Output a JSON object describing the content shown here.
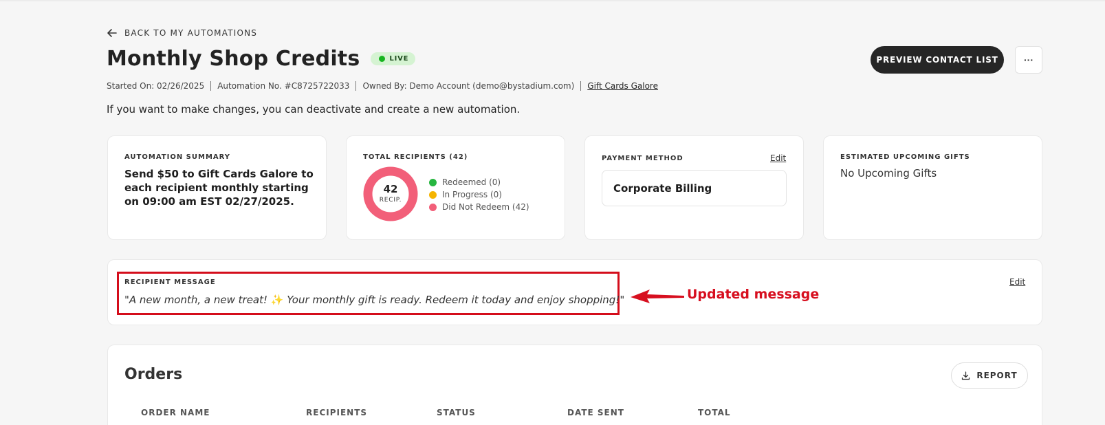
{
  "header": {
    "back_label": "BACK TO MY AUTOMATIONS",
    "title": "Monthly Shop Credits",
    "status_badge": "LIVE",
    "meta": {
      "started": "Started On: 02/26/2025",
      "automation_no": "Automation No. #C8725722033",
      "owner": "Owned By: Demo Account (demo@bystadium.com)",
      "merchant": "Gift Cards Galore"
    },
    "info": "If you want to make changes, you can deactivate and create a new automation.",
    "preview_button": "PREVIEW CONTACT LIST",
    "more_button": "···"
  },
  "cards": {
    "summary": {
      "label": "AUTOMATION SUMMARY",
      "text": "Send $50 to Gift Cards Galore to each recipient monthly starting on 09:00 am EST 02/27/2025."
    },
    "recipients": {
      "label": "TOTAL RECIPIENTS (42)",
      "count": "42",
      "unit": "RECIP.",
      "legend": [
        {
          "label": "Redeemed (0)",
          "value": 0,
          "color": "#27b640"
        },
        {
          "label": "In Progress (0)",
          "value": 0,
          "color": "#f5b400"
        },
        {
          "label": "Did Not Redeem (42)",
          "value": 42,
          "color": "#f25f79"
        }
      ]
    },
    "payment": {
      "label": "PAYMENT METHOD",
      "edit": "Edit",
      "method": "Corporate Billing"
    },
    "upcoming": {
      "label": "ESTIMATED UPCOMING GIFTS",
      "text": "No Upcoming Gifts"
    }
  },
  "message": {
    "label": "RECIPIENT MESSAGE",
    "text_before": "\"A new month, a new treat! ",
    "emoji": "✨",
    "text_after": " Your monthly gift is ready. Redeem it today and enjoy shopping!\"",
    "edit": "Edit",
    "annotation": "Updated message",
    "annotation_color": "#d70f1f"
  },
  "orders": {
    "title": "Orders",
    "report_button": "REPORT",
    "columns": [
      "ORDER NAME",
      "RECIPIENTS",
      "STATUS",
      "DATE SENT",
      "TOTAL"
    ]
  }
}
